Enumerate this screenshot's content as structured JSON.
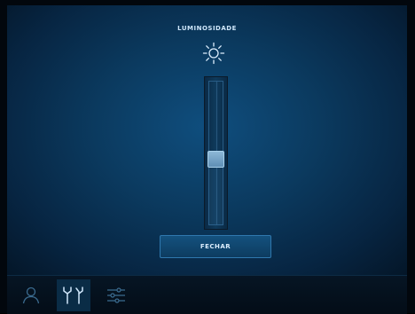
{
  "brightness": {
    "title": "LUMINOSIDADE",
    "level": 0.45
  },
  "buttons": {
    "close_label": "FECHAR"
  },
  "bottom_nav": {
    "tabs": [
      {
        "icon": "person-icon",
        "active": false
      },
      {
        "icon": "tools-icon",
        "active": true
      },
      {
        "icon": "sliders-icon",
        "active": false
      }
    ]
  },
  "colors": {
    "accent": "#2f78ae",
    "background": "#0b3a5f",
    "icon_active": "#cfe7fb",
    "icon_inactive": "#3b6b8f"
  }
}
